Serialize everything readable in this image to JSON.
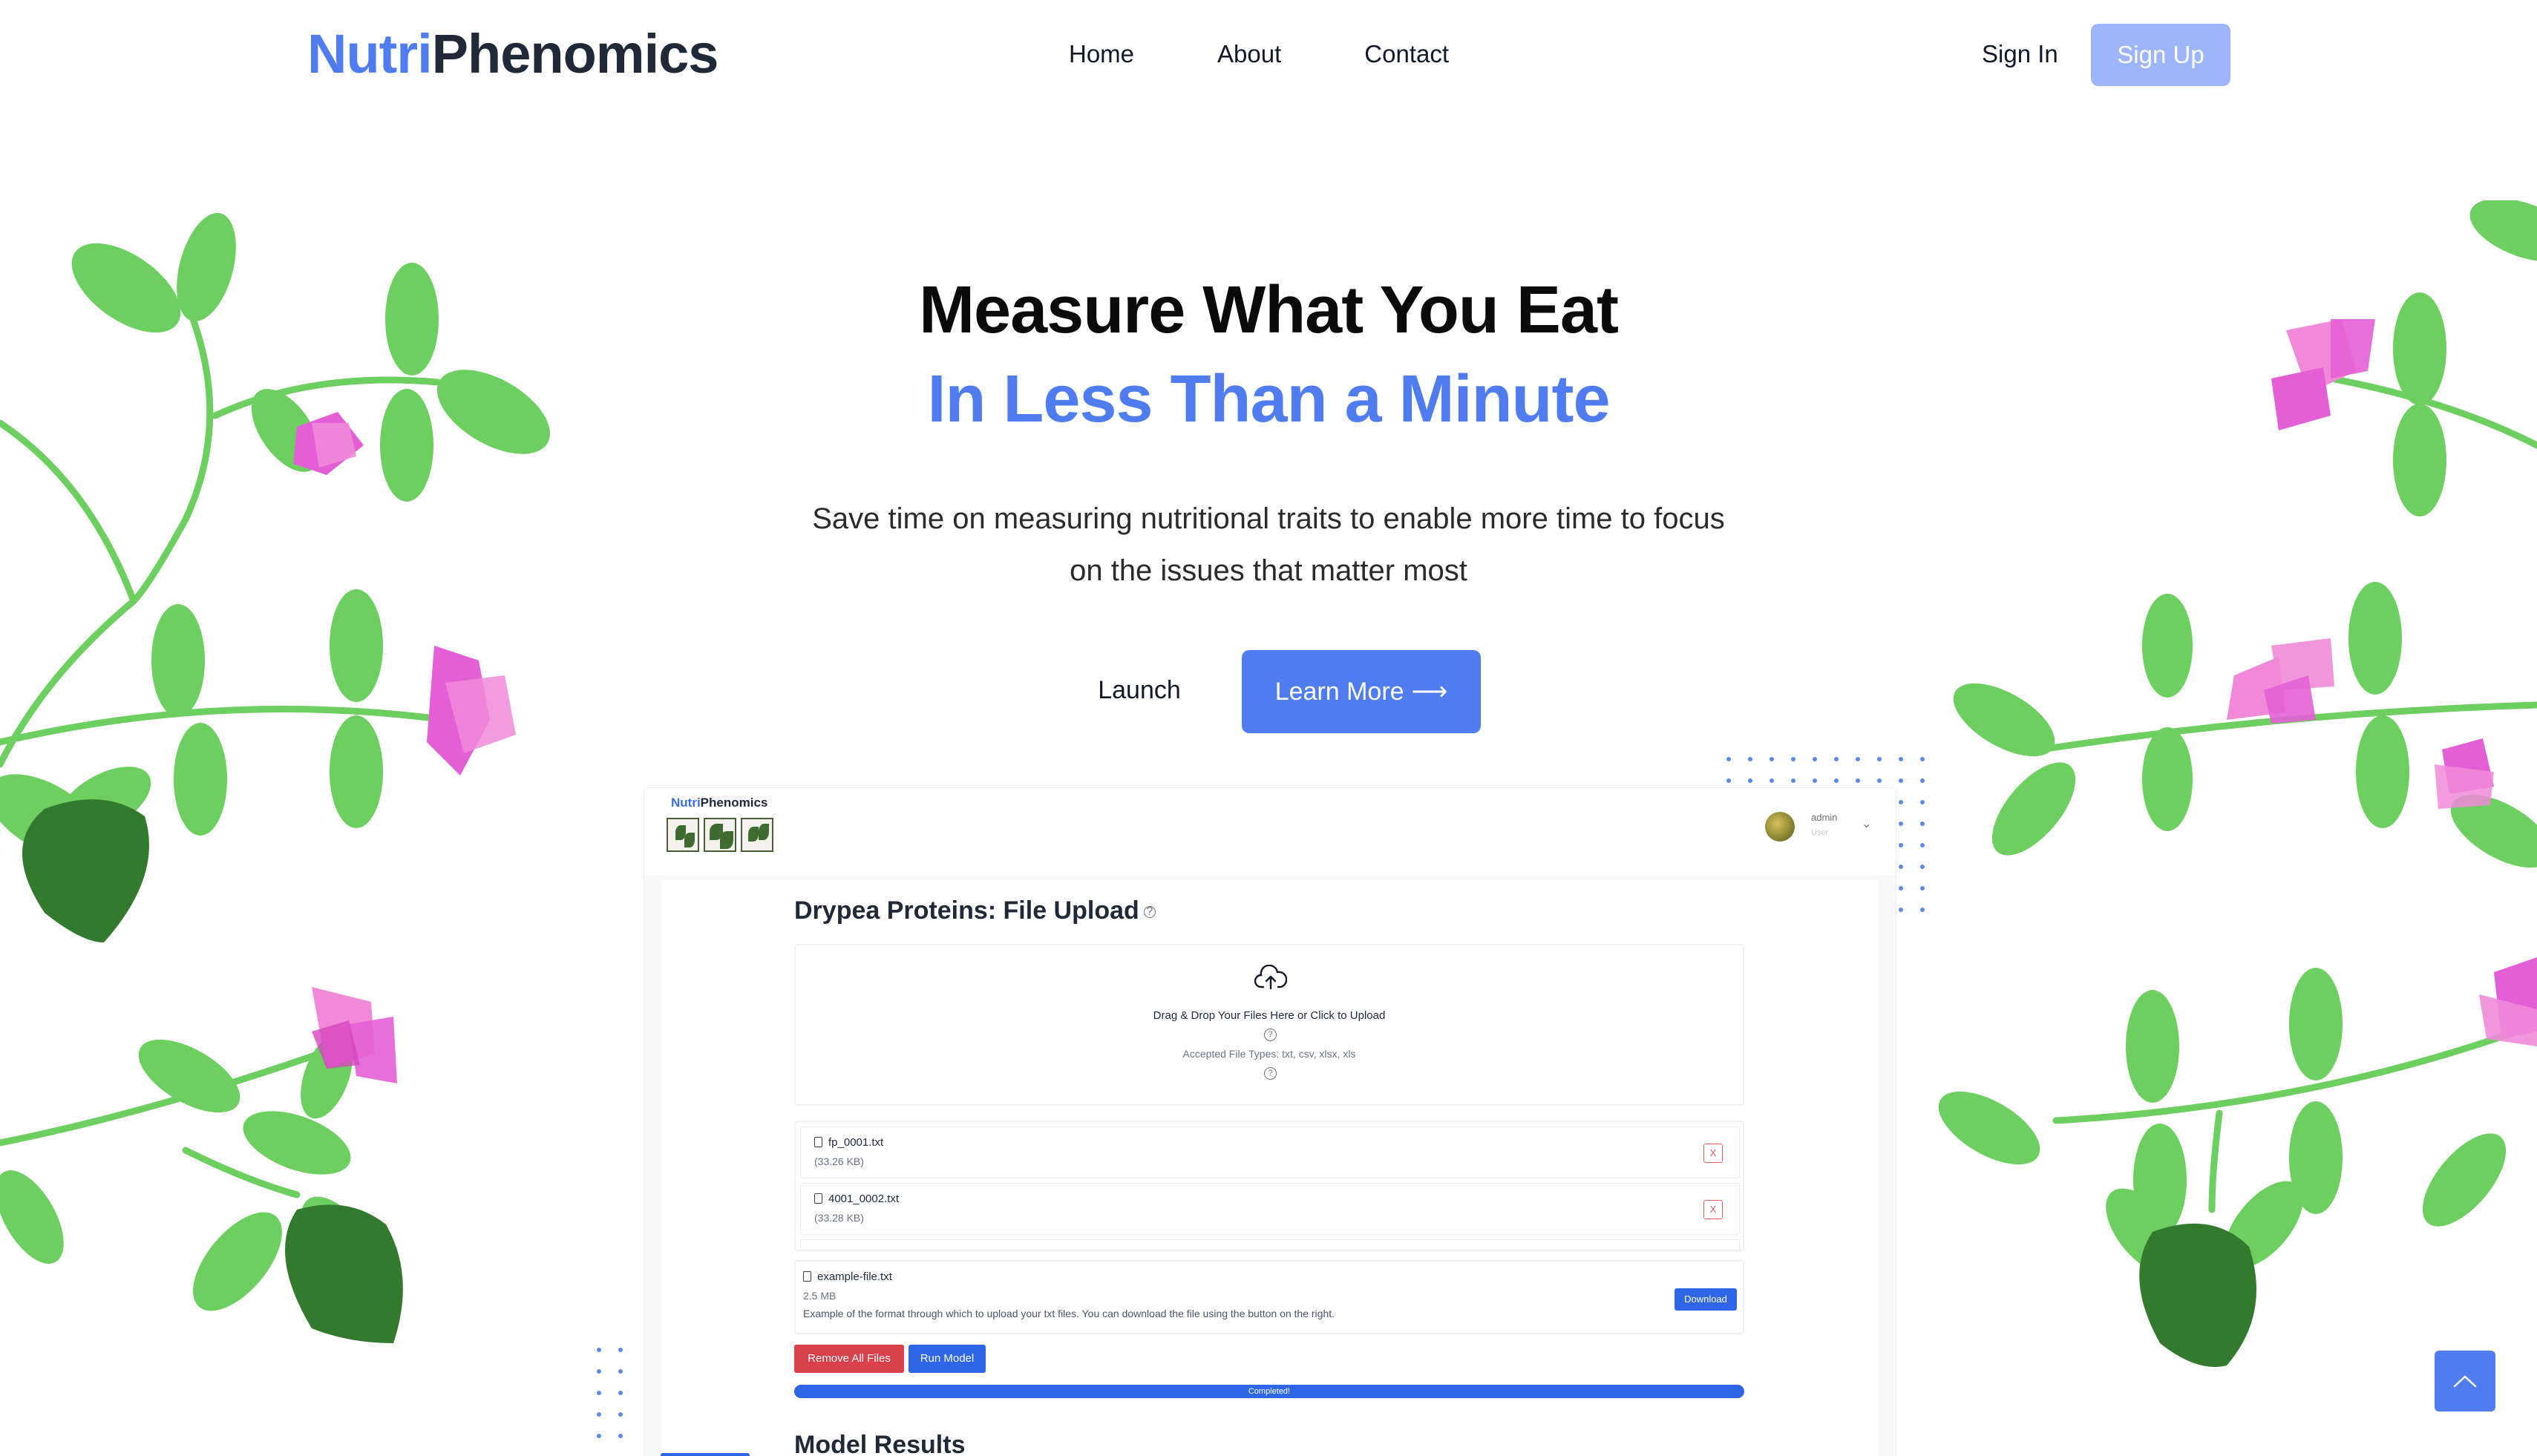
{
  "brand": {
    "part1": "Nutri",
    "part2": "Phenomics"
  },
  "nav": {
    "links": [
      "Home",
      "About",
      "Contact"
    ],
    "sign_in": "Sign In",
    "sign_up": "Sign Up"
  },
  "hero": {
    "title_line1": "Measure What You Eat",
    "title_line2": "In Less Than a Minute",
    "subtitle": "Save time on measuring nutritional traits to enable more time to focus on the issues that matter most",
    "launch_label": "Launch",
    "learn_more_label": "Learn More",
    "learn_more_icon": "arrow-right-icon"
  },
  "preview": {
    "brand_part1": "Nutri",
    "brand_part2": "Phenomics",
    "user_name": "admin",
    "user_role": "User",
    "page_title": "Drypea Proteins: File Upload",
    "dropzone_text": "Drag & Drop Your Files Here or Click to Upload",
    "accepted_types": "Accepted File Types: txt, csv, xlsx, xls",
    "files": [
      {
        "name": "fp_0001.txt",
        "size": "(33.26 KB)",
        "remove": "X"
      },
      {
        "name": "4001_0002.txt",
        "size": "(33.28 KB)",
        "remove": "X"
      }
    ],
    "example": {
      "name": "example-file.txt",
      "size": "2.5 MB",
      "description": "Example of the format through which to upload your txt files. You can download the file using the button on the right.",
      "download_label": "Download"
    },
    "remove_all_label": "Remove All Files",
    "run_model_label": "Run Model",
    "progress_label": "Completed!",
    "progress_value": 1.0,
    "results_heading": "Model Results"
  },
  "colors": {
    "accent": "#4f7df0",
    "signup_bg": "#9cb5fb",
    "leaf": "#6ccf5f",
    "leaf_dark": "#347a2e",
    "petal": "#e45fd6",
    "danger": "#d9404a"
  }
}
